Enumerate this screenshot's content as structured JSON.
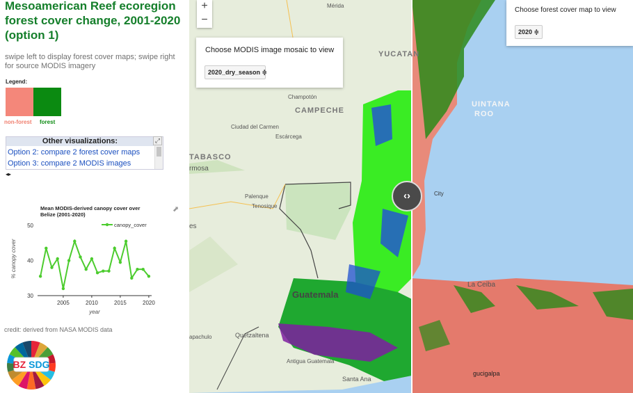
{
  "sidebar": {
    "title": "Mesoamerican Reef ecoregion forest cover change, 2001-2020 (option 1)",
    "subtitle": "swipe left to display forest cover maps; swipe right for source MODIS imagery",
    "legend": {
      "title": "Legend:",
      "items": [
        {
          "label": "non-forest",
          "color": "#f4877a"
        },
        {
          "label": "forest",
          "color": "#0b8a11"
        }
      ]
    },
    "other": {
      "heading": "Other visualizations:",
      "links": [
        "Option 2: compare 2 forest cover maps",
        "Option 3: compare 2 MODIS images"
      ],
      "expand_icon": "expand-icon",
      "scroll_arrows": "◂▸"
    },
    "credit": "credit: derived from NASA MODIS data",
    "logo_text": "BZ SDG"
  },
  "chart_data": {
    "type": "line",
    "title": "Mean MODIS-derived canopy cover over Belize (2001-2020)",
    "xlabel": "year",
    "ylabel": "% canopy cover",
    "series": [
      {
        "name": "canopy_cover",
        "color": "#4ccc2e",
        "x": [
          2001,
          2002,
          2003,
          2004,
          2005,
          2006,
          2007,
          2008,
          2009,
          2010,
          2011,
          2012,
          2013,
          2014,
          2015,
          2016,
          2017,
          2018,
          2019,
          2020
        ],
        "values": [
          35.5,
          43.5,
          38,
          40.5,
          32,
          40,
          45.5,
          41,
          37.5,
          40.5,
          36.5,
          37,
          37,
          43.5,
          39.5,
          45.5,
          35,
          37.5,
          37.5,
          35.5
        ]
      }
    ],
    "xticks": [
      2005,
      2010,
      2015,
      2020
    ],
    "yticks": [
      30,
      40,
      50
    ],
    "xlim": [
      2000.5,
      2020.5
    ],
    "ylim": [
      30,
      51
    ],
    "grid": false,
    "legend": "top-right"
  },
  "map": {
    "zoom_in": "+",
    "zoom_out": "−",
    "left_panel": {
      "label": "Choose MODIS image mosaic to view",
      "selected": "2020_dry_season ≑"
    },
    "right_panel": {
      "label": "Choose forest cover map to view",
      "selected": "2020 ≑"
    },
    "swipe_handle": "‹›",
    "place_labels": {
      "merida": "Mérida",
      "yucatan": "YUCATAN",
      "campeche": "CAMPECHE",
      "quintana": "UINTANA",
      "roo": "ROO",
      "tabasco": "TABASCO",
      "ermosa": "rmosa",
      "guatemala": "Guatemala",
      "la_ceiba": "La Ceiba",
      "quetzaltena": "Quetzaltena",
      "antigua": "Antigua Guatemala",
      "santa_ana": "Santa Ana",
      "tegucigalpa": "gucigalpa",
      "apachulo": "apachulo",
      "ciudad_carmen": "Ciudad del Carmen",
      "escarcega": "Escárcega",
      "champoton": "Champotón",
      "palenque": "Palenque",
      "tenosique": "Tenosique",
      "city": "City",
      "es": "es"
    }
  }
}
